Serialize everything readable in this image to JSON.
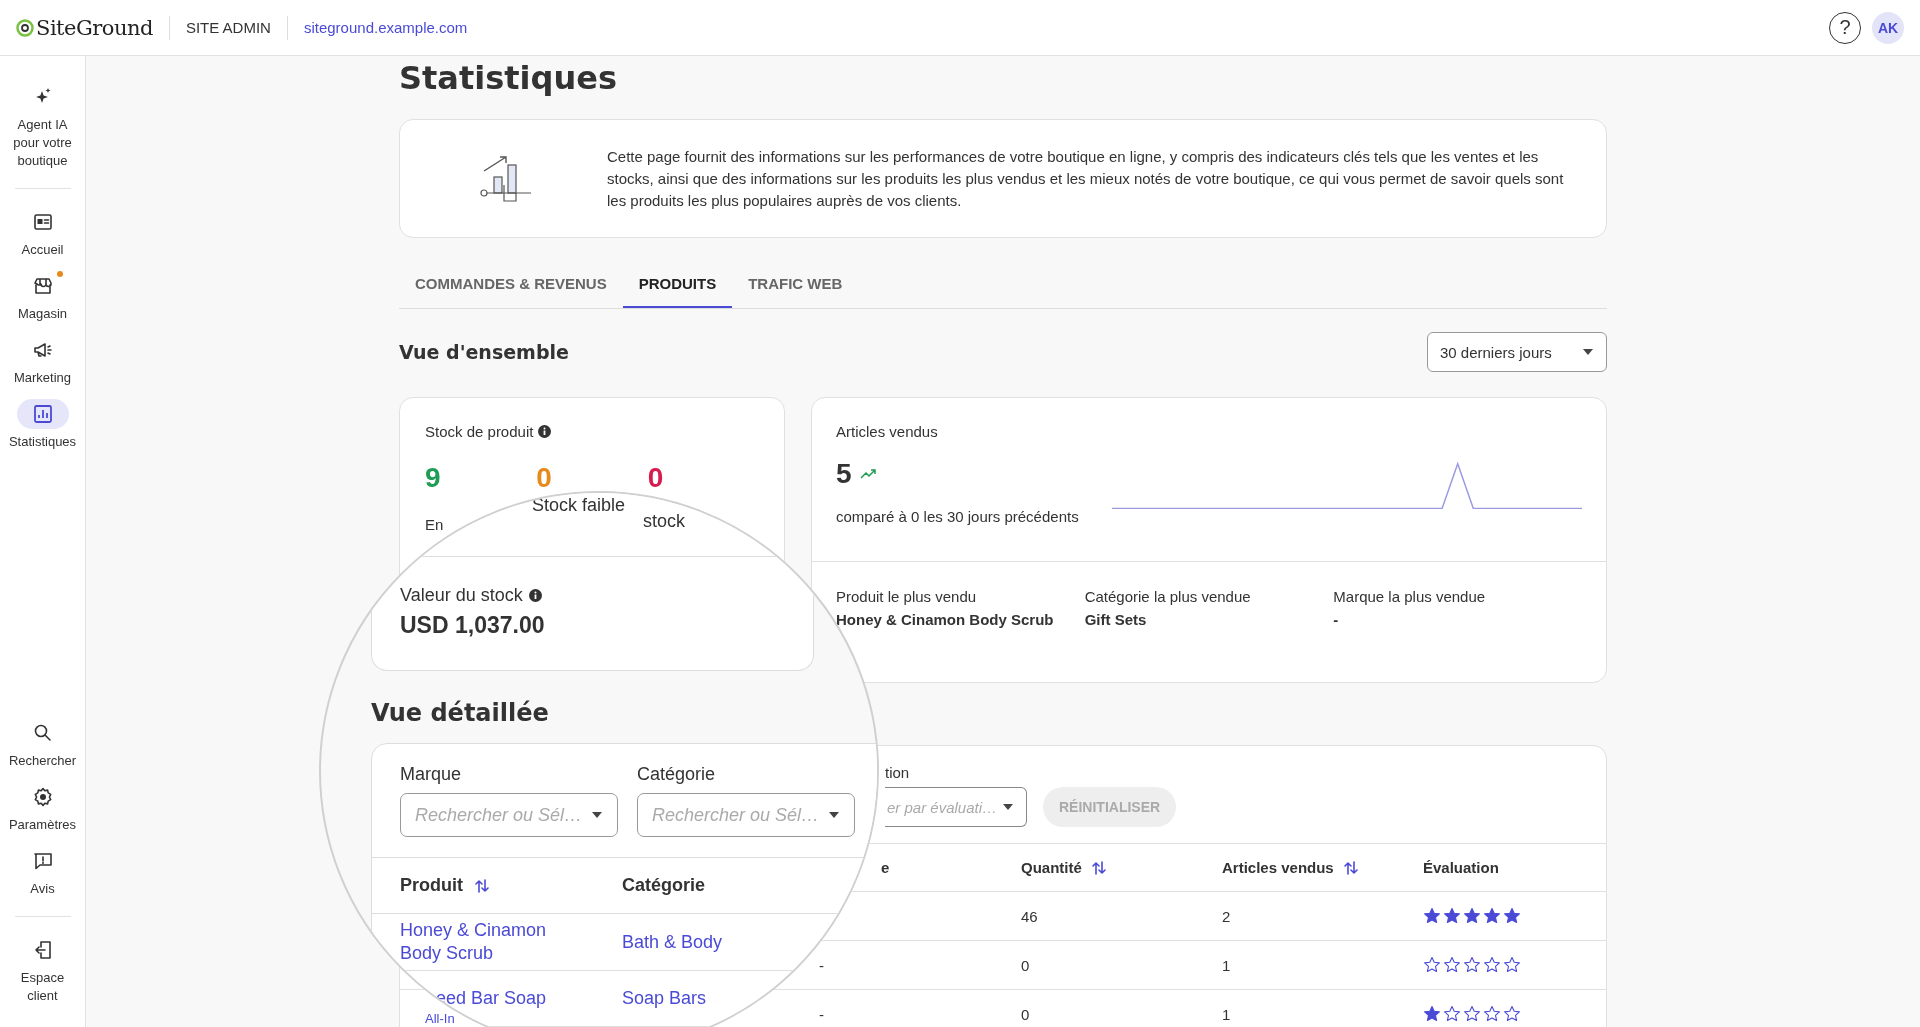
{
  "header": {
    "logo": "SiteGround",
    "section": "SITE ADMIN",
    "domain": "siteground.example.com",
    "help": "?",
    "avatar": "AK"
  },
  "sidebar": {
    "groups": [
      [
        {
          "label": "Agent IA pour votre boutique",
          "selected": false,
          "notification": false
        }
      ],
      [
        {
          "label": "Accueil",
          "selected": false,
          "notification": false
        },
        {
          "label": "Magasin",
          "selected": false,
          "notification": true
        },
        {
          "label": "Marketing",
          "selected": false,
          "notification": false
        },
        {
          "label": "Statistiques",
          "selected": true,
          "notification": false
        }
      ],
      [
        {
          "label": "Rechercher",
          "selected": false,
          "notification": false
        },
        {
          "label": "Paramètres",
          "selected": false,
          "notification": false
        },
        {
          "label": "Avis",
          "selected": false,
          "notification": false
        }
      ],
      [
        {
          "label": "Espace client",
          "selected": false,
          "notification": false
        }
      ]
    ]
  },
  "page": {
    "title": "Statistiques",
    "intro": "Cette page fournit des informations sur les performances de votre boutique en ligne, y compris des indicateurs clés tels que les ventes et les stocks, ainsi que des informations sur les produits les plus vendus et les mieux notés de votre boutique, ce qui vous permet de savoir quels sont les produits les plus populaires auprès de vos clients."
  },
  "tabs": [
    {
      "label": "COMMANDES & REVENUS",
      "selected": false
    },
    {
      "label": "PRODUITS",
      "selected": true
    },
    {
      "label": "TRAFIC WEB",
      "selected": false
    }
  ],
  "overview": {
    "title": "Vue d'ensemble",
    "period": "30 derniers jours"
  },
  "stock_card": {
    "title": "Stock de produit",
    "counts": [
      {
        "value": "9",
        "color": "#1f9d55"
      },
      {
        "value": "0",
        "color": "#e8891b"
      },
      {
        "value": "0",
        "color": "#d81b4f"
      }
    ],
    "label_fragment": "En"
  },
  "sales_card": {
    "title": "Articles vendus",
    "value": "5",
    "comparison": "comparé à 0 les 30 jours précédents",
    "bests": [
      {
        "label": "Produit le plus vendu",
        "value": "Honey & Cinamon Body Scrub"
      },
      {
        "label": "Catégorie la plus vendue",
        "value": "Gift Sets"
      },
      {
        "label": "Marque la plus vendue",
        "value": "-"
      }
    ]
  },
  "filters": {
    "label_fragment": "tion",
    "placeholder_fragment": "er par évaluati…",
    "reset": {
      "label": "RÉINITIALISER",
      "disabled": true
    }
  },
  "table": {
    "columns": [
      {
        "label": "e",
        "sortable": false
      },
      {
        "label": "Quantité",
        "sortable": true
      },
      {
        "label": "Articles vendus",
        "sortable": true
      },
      {
        "label": "Évaluation",
        "sortable": false
      }
    ],
    "rows": [
      {
        "quantity": "46",
        "sold": "2",
        "stars": 5
      },
      {
        "brand": "-",
        "quantity": "0",
        "sold": "1",
        "stars": 0
      },
      {
        "product_fragment": "All-In",
        "brand": "-",
        "quantity": "0",
        "sold": "1",
        "stars": 1
      }
    ]
  },
  "magnifier": {
    "stock_labels": [
      "Stock faible",
      "stock"
    ],
    "stock_value": {
      "label": "Valeur du stock",
      "value": "USD 1,037.00"
    },
    "section_title": "Vue détaillée",
    "filters": [
      {
        "label": "Marque",
        "placeholder": "Rechercher ou Sél…"
      },
      {
        "label": "Catégorie",
        "placeholder": "Rechercher ou Sél…"
      }
    ],
    "columns": [
      {
        "label": "Produit",
        "sortable": true
      },
      {
        "label": "Catégorie",
        "sortable": false
      }
    ],
    "rows": [
      {
        "product": "Honey & Cinamon Body Scrub",
        "category": "Bath & Body",
        "indented": false
      },
      {
        "product": "eed Bar Soap",
        "category": "Soap Bars",
        "indented": true
      }
    ]
  }
}
